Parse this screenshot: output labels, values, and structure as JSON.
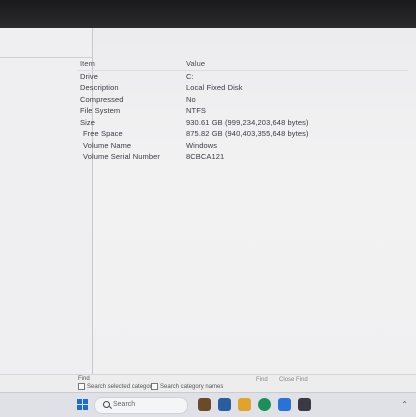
{
  "list": {
    "headers": {
      "item": "Item",
      "value": "Value"
    },
    "rows": [
      {
        "item": "Drive",
        "value": "C:"
      },
      {
        "item": "Description",
        "value": "Local Fixed Disk"
      },
      {
        "item": "Compressed",
        "value": "No"
      },
      {
        "item": "File System",
        "value": "NTFS"
      },
      {
        "item": "Size",
        "value": "930.61 GB (999,234,203,648 bytes)"
      },
      {
        "item": "Free Space",
        "value": "875.82 GB (940,403,355,648 bytes)"
      },
      {
        "item": "Volume Name",
        "value": "Windows"
      },
      {
        "item": "Volume Serial Number",
        "value": "8CBCA121"
      }
    ]
  },
  "findbar": {
    "label": "Find",
    "search_selected": "Search selected categor",
    "search_names": "Search category names",
    "find_button": "Find",
    "close_find_button": "Close Find"
  },
  "taskbar": {
    "search_placeholder": "Search",
    "colors": {
      "start": "#1a6fd1",
      "app1": "#6b4a2a",
      "app2": "#2a5d9e",
      "app3": "#e0a32b",
      "app4": "#1b8f5a",
      "app5": "#2b72d6",
      "app6": "#3a3a44"
    }
  }
}
